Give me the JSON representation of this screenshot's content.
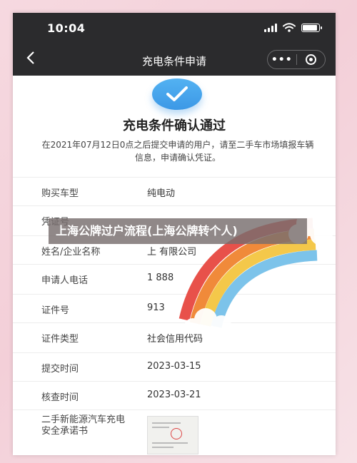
{
  "status_bar": {
    "time": "10:04",
    "battery_level": 0.85
  },
  "nav": {
    "title": "充电条件申请",
    "more_label": "•••"
  },
  "result": {
    "title": "充电条件确认通过",
    "description": "在2021年07月12日0点之后提交申请的用户，请至二手车市场填报车辆信息，申请确认凭证。"
  },
  "fields": [
    {
      "label": "购买车型",
      "value": "纯电动"
    },
    {
      "label": "凭证号",
      "value": ""
    },
    {
      "label": "姓名/企业名称",
      "value": "上 有限公司"
    },
    {
      "label": "申请人电话",
      "value": "1 888"
    },
    {
      "label": "证件号",
      "value": "913"
    },
    {
      "label": "证件类型",
      "value": "社会信用代码"
    },
    {
      "label": "提交时间",
      "value": "2023-03-15"
    },
    {
      "label": "核查时间",
      "value": "2023-03-21"
    },
    {
      "label": "二手新能源汽车充电安全承诺书",
      "value": ""
    }
  ],
  "overlay_caption": "上海公牌过户流程(上海公牌转个人)",
  "colors": {
    "nav_bg": "#2b2b2d",
    "accent_blue": "#3c98e6",
    "page_bg": "#f6d9e0"
  },
  "icons": [
    "signal-icon",
    "wifi-icon",
    "battery-icon",
    "back-arrow-icon",
    "more-icon",
    "close-mini-program-icon",
    "check-icon",
    "document-thumbnail-icon",
    "rainbow-sticker-icon"
  ]
}
